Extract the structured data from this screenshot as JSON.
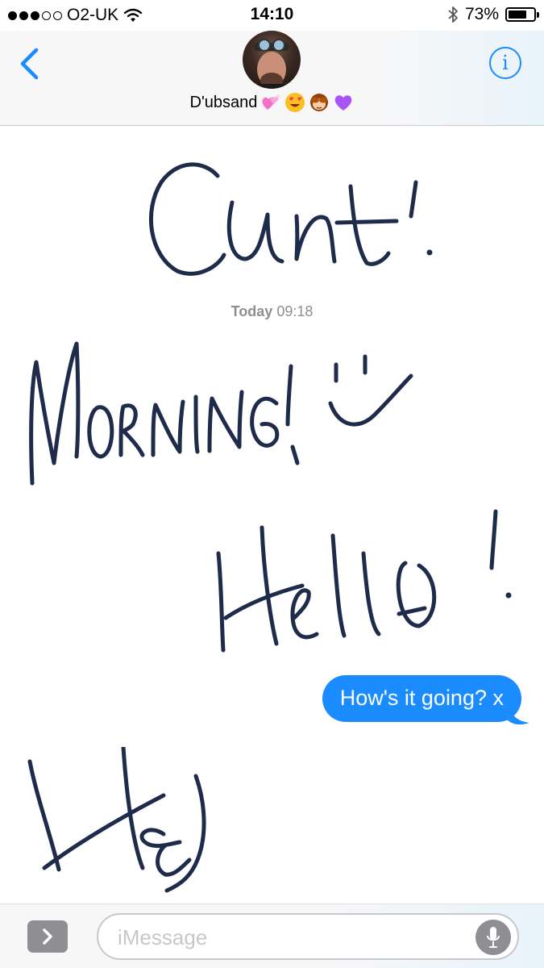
{
  "status_bar": {
    "signal_filled": 3,
    "signal_total": 5,
    "carrier": "O2-UK",
    "time": "14:10",
    "battery_percent": "73%",
    "battery_level": 0.73,
    "icons": [
      "wifi-icon",
      "bluetooth-icon",
      "battery-icon"
    ]
  },
  "header": {
    "contact_name": "D'ubsand",
    "name_emojis": [
      "sparkling-hearts-icon",
      "heart-eyes-icon",
      "see-no-evil-monkey-icon",
      "purple-heart-icon"
    ],
    "back_icon": "chevron-left-icon",
    "info_icon": "info-icon",
    "info_glyph": "i"
  },
  "conversation": {
    "timestamp_day": "Today",
    "timestamp_time": "09:18",
    "messages": [
      {
        "type": "handwriting",
        "direction": "outgoing",
        "text": "Cunt!"
      },
      {
        "type": "handwriting",
        "direction": "incoming",
        "text": "Morning! :)"
      },
      {
        "type": "handwriting",
        "direction": "outgoing",
        "text": "Hello!"
      },
      {
        "type": "text",
        "direction": "outgoing",
        "text": "How's it going? x"
      },
      {
        "type": "handwriting",
        "direction": "incoming",
        "text": "Hej"
      }
    ]
  },
  "input_bar": {
    "placeholder": "iMessage",
    "apps_icon": "chevron-right-icon",
    "mic_icon": "microphone-icon"
  },
  "colors": {
    "accent": "#1a8cff",
    "ink": "#1e2b4a",
    "timestamp": "#8e8e93",
    "bubble_text": "#ffffff"
  }
}
